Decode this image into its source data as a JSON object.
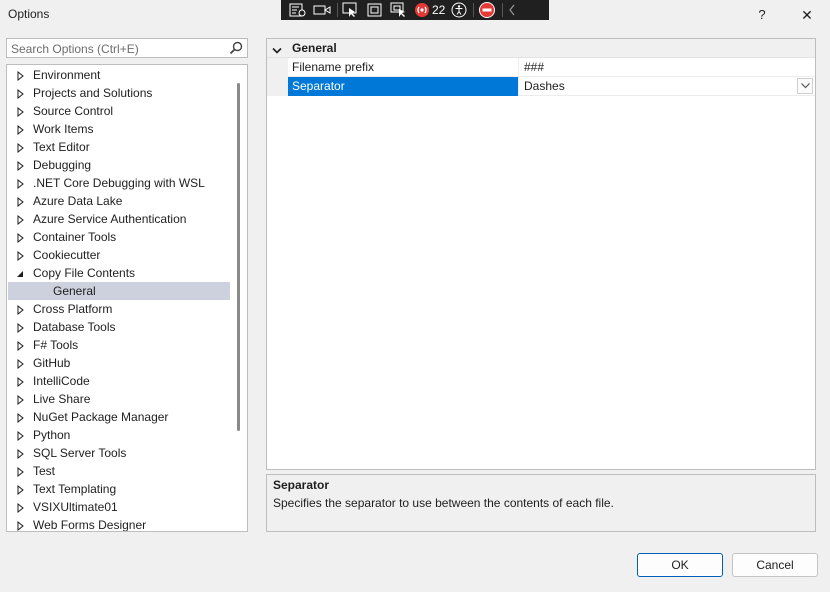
{
  "window": {
    "title": "Options",
    "help_glyph": "?",
    "close_glyph": "✕"
  },
  "devtoolbar": {
    "counter": "22"
  },
  "search": {
    "placeholder": "Search Options (Ctrl+E)"
  },
  "tree": {
    "items": [
      {
        "label": "Environment",
        "expanded": false
      },
      {
        "label": "Projects and Solutions",
        "expanded": false
      },
      {
        "label": "Source Control",
        "expanded": false
      },
      {
        "label": "Work Items",
        "expanded": false
      },
      {
        "label": "Text Editor",
        "expanded": false
      },
      {
        "label": "Debugging",
        "expanded": false
      },
      {
        "label": ".NET Core Debugging with WSL",
        "expanded": false
      },
      {
        "label": "Azure Data Lake",
        "expanded": false
      },
      {
        "label": "Azure Service Authentication",
        "expanded": false
      },
      {
        "label": "Container Tools",
        "expanded": false
      },
      {
        "label": "Cookiecutter",
        "expanded": false
      },
      {
        "label": "Copy File Contents",
        "expanded": true
      },
      {
        "label": "General",
        "child": true,
        "selected": true
      },
      {
        "label": "Cross Platform",
        "expanded": false
      },
      {
        "label": "Database Tools",
        "expanded": false
      },
      {
        "label": "F# Tools",
        "expanded": false
      },
      {
        "label": "GitHub",
        "expanded": false
      },
      {
        "label": "IntelliCode",
        "expanded": false
      },
      {
        "label": "Live Share",
        "expanded": false
      },
      {
        "label": "NuGet Package Manager",
        "expanded": false
      },
      {
        "label": "Python",
        "expanded": false
      },
      {
        "label": "SQL Server Tools",
        "expanded": false
      },
      {
        "label": "Test",
        "expanded": false
      },
      {
        "label": "Text Templating",
        "expanded": false
      },
      {
        "label": "VSIXUltimate01",
        "expanded": false
      },
      {
        "label": "Web Forms Designer",
        "expanded": false
      }
    ]
  },
  "grid": {
    "category": "General",
    "properties": [
      {
        "name": "Filename prefix",
        "value": "###"
      },
      {
        "name": "Separator",
        "value": "Dashes"
      }
    ]
  },
  "description": {
    "title": "Separator",
    "text": "Specifies the separator to use between the contents of each file."
  },
  "buttons": {
    "ok": "OK",
    "cancel": "Cancel"
  },
  "colors": {
    "selection_blue": "#0078d7",
    "tree_selection": "#ccd1dd",
    "devbar_bg": "#202020",
    "record_red": "#e53935"
  }
}
